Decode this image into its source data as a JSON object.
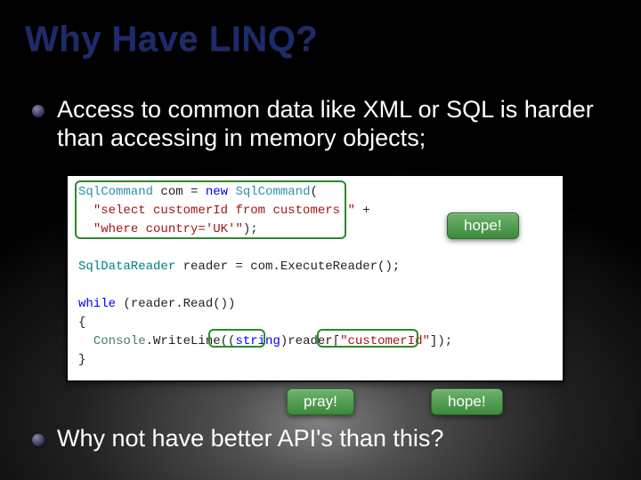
{
  "title": "Why Have LINQ?",
  "bullets": {
    "b1": "Access to common data like XML or SQL is harder than accessing in memory objects;",
    "b2": "Why not have better API's than this?"
  },
  "code": {
    "l1a": "SqlCommand",
    "l1b": " com = ",
    "l1c": "new",
    "l1d": " ",
    "l1e": "SqlCommand",
    "l1f": "(",
    "l2a": "  ",
    "l2b": "\"select customerId from customers \"",
    "l2c": " +",
    "l3a": "  ",
    "l3b": "\"where country='UK'\"",
    "l3c": ");",
    "l4": " ",
    "l5a": "SqlDataReader",
    "l5b": " reader = com.ExecuteReader();",
    "l6": " ",
    "l7a": "while",
    "l7b": " (reader.Read())",
    "l8": "{",
    "l9a": "  ",
    "l9b": "Console",
    "l9c": ".WriteLine((",
    "l9d": "string",
    "l9e": ")reader[",
    "l9f": "\"customerId\"",
    "l9g": "]);",
    "l10": "}"
  },
  "callouts": {
    "c1": "hope!",
    "c2": "pray!",
    "c3": "hope!"
  }
}
